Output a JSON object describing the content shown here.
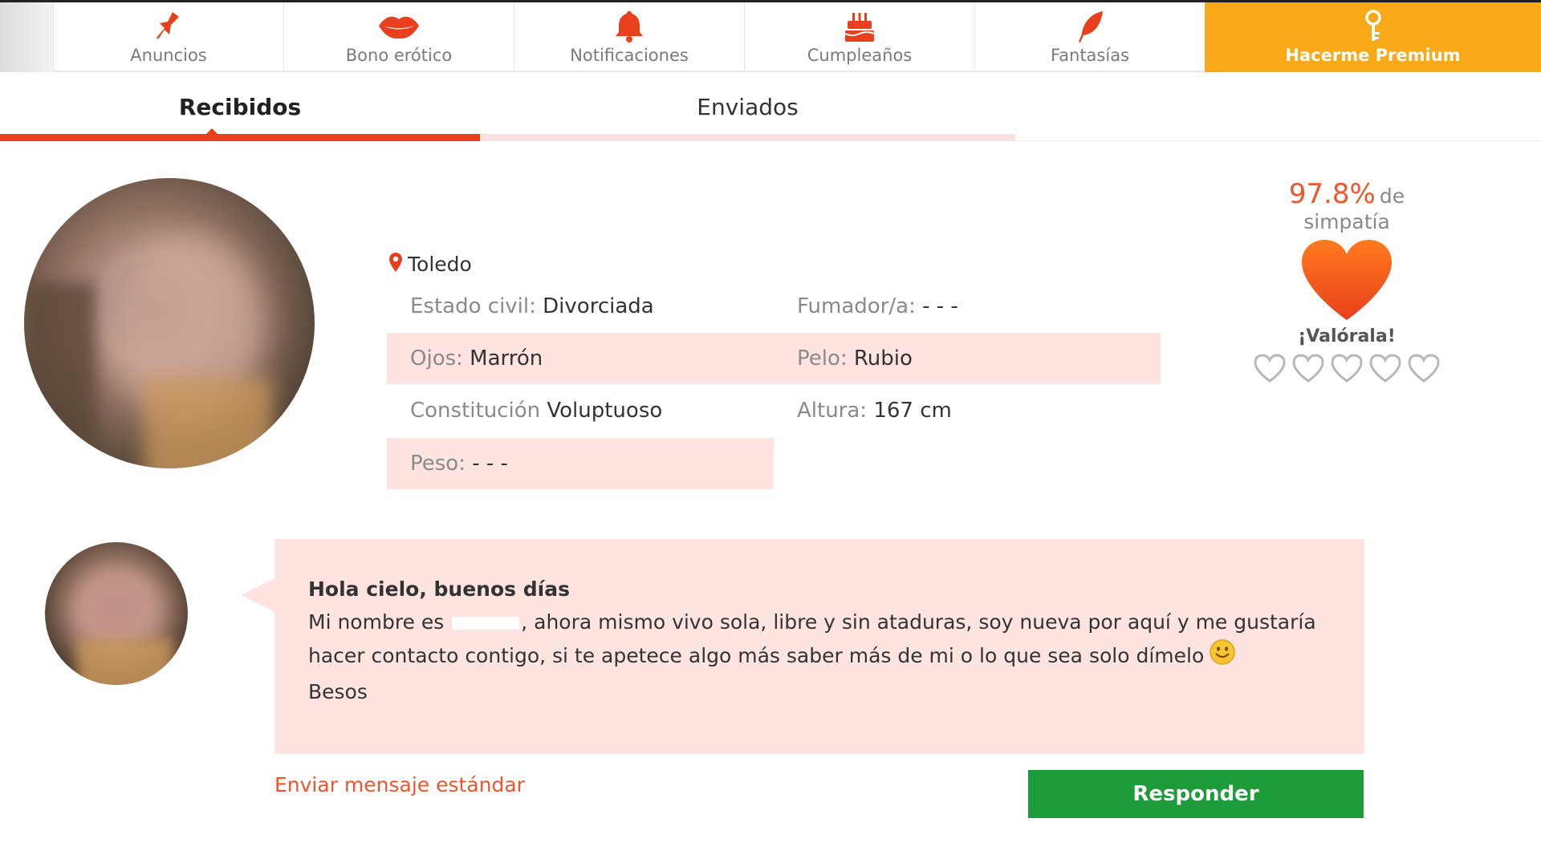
{
  "topnav": {
    "items": [
      {
        "label": "Anuncios",
        "icon": "pin-icon"
      },
      {
        "label": "Bono erótico",
        "icon": "lips-icon"
      },
      {
        "label": "Notificaciones",
        "icon": "bell-icon"
      },
      {
        "label": "Cumpleaños",
        "icon": "cake-icon"
      },
      {
        "label": "Fantasías",
        "icon": "feather-icon"
      },
      {
        "label": "Hacerme Premium",
        "icon": "key-icon"
      }
    ]
  },
  "tabs": {
    "received": "Recibidos",
    "sent": "Enviados"
  },
  "profile": {
    "location": "Toledo",
    "attributes": {
      "estado_civil": {
        "label": "Estado civil:",
        "value": "Divorciada"
      },
      "fumador": {
        "label": "Fumador/a:",
        "value": "- - -"
      },
      "ojos": {
        "label": "Ojos:",
        "value": "Marrón"
      },
      "pelo": {
        "label": "Pelo:",
        "value": "Rubio"
      },
      "constitucion": {
        "label": "Constitución",
        "value": "Voluptuoso"
      },
      "altura": {
        "label": "Altura:",
        "value": "167 cm"
      },
      "peso": {
        "label": "Peso:",
        "value": "- - -"
      }
    }
  },
  "sympathy": {
    "percent": "97.8%",
    "suffix": "de simpatía",
    "rate_label": "¡Valórala!",
    "stars_total": 5,
    "stars_filled": 0
  },
  "message": {
    "greeting": "Hola cielo, buenos días",
    "line1_before": "Mi nombre es",
    "line1_after": ", ahora mismo vivo sola, libre y sin ataduras, soy nueva por aquí y me gustaría",
    "line2": "hacer contacto contigo, si te apetece algo más saber más de mi o lo que sea solo dímelo",
    "signoff": "Besos"
  },
  "actions": {
    "standard_message": "Enviar mensaje estándar",
    "reply": "Responder"
  },
  "colors": {
    "accent": "#f2552c",
    "premium": "#f9a818",
    "reply": "#1e9b3a",
    "shade": "#fde4e0"
  }
}
